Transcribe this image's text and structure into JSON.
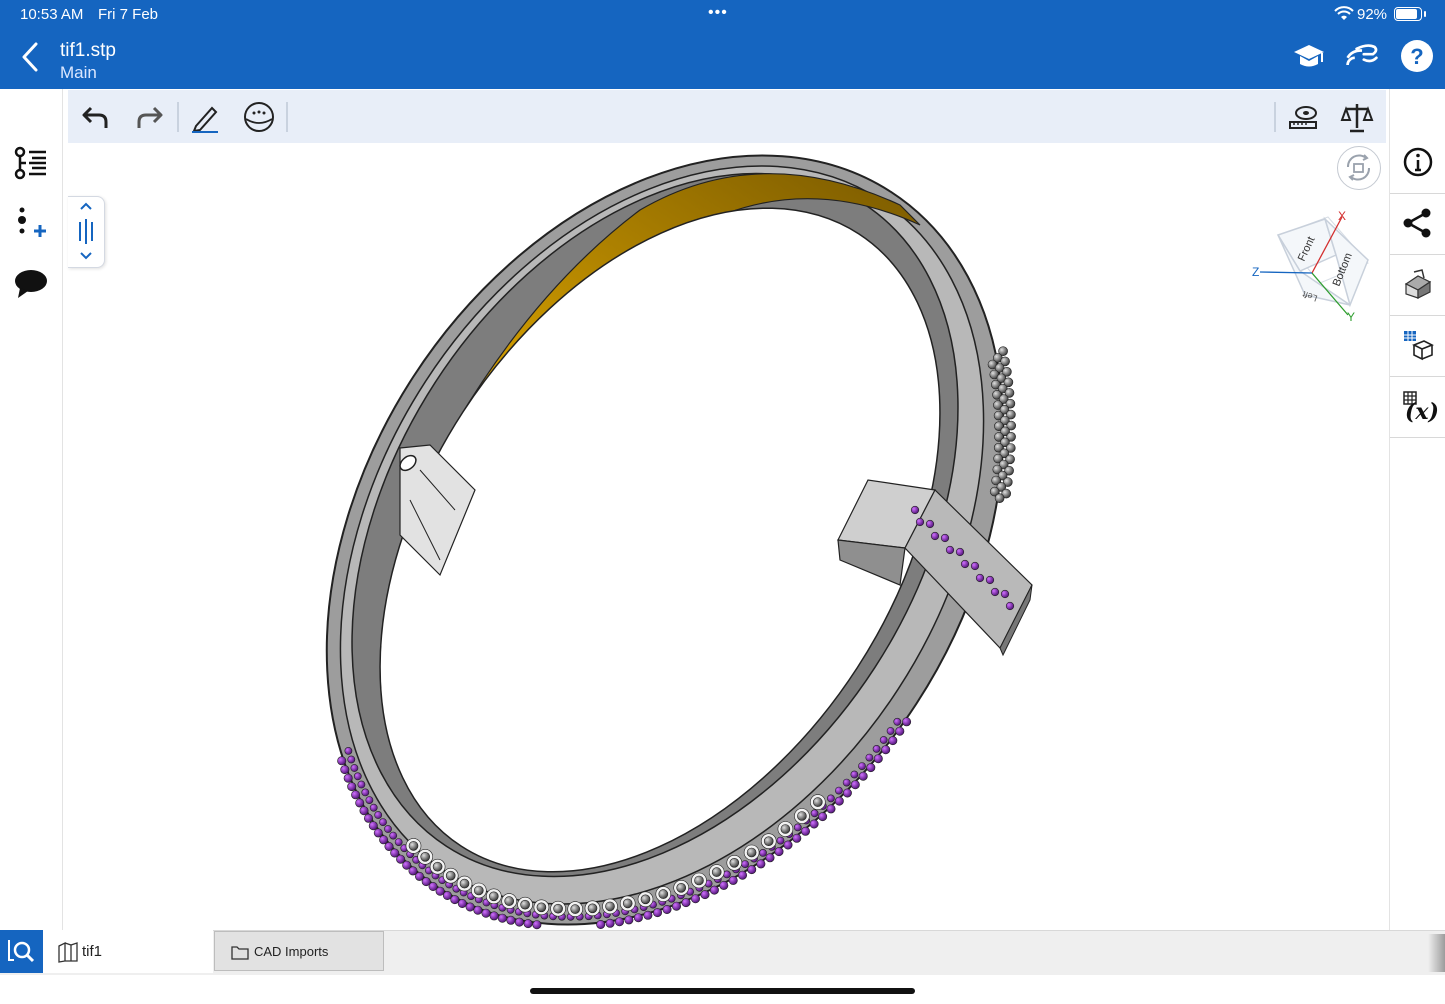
{
  "status_bar": {
    "time": "10:53 AM",
    "date": "Fri 7 Feb",
    "dots": "•••",
    "battery": "92%",
    "battery_level": 0.92
  },
  "header": {
    "title": "tif1.stp",
    "subtitle": "Main",
    "background": "#1565C0",
    "icons": [
      "back-chevron",
      "learning-center-icon",
      "follow-mode-icon",
      "help-icon"
    ]
  },
  "toolbar": {
    "icons": [
      "undo-icon",
      "redo-icon",
      "sketch-pencil-icon",
      "appearance-sphere-icon",
      "measure-tape-icon",
      "mass-properties-icon"
    ]
  },
  "left_rail": {
    "icons": [
      "feature-list-icon",
      "add-insert-icon",
      "comments-icon"
    ]
  },
  "right_rail": {
    "icons": [
      "info-icon",
      "share-icon",
      "render-style-icon",
      "configurations-icon",
      "variables-icon"
    ]
  },
  "viewcube": {
    "faces": [
      "Front",
      "Bottom",
      "Left"
    ],
    "axes": [
      "X",
      "Y",
      "Z"
    ],
    "axis_colors": {
      "X": "#d32f2f",
      "Y": "#2e9e2e",
      "Z": "#1565C0"
    }
  },
  "model": {
    "colors": {
      "body": "#a9a9a9",
      "inner_face": "#e0a000",
      "gems_purple": "#7b1fa2",
      "gems_gray": "#555555"
    }
  },
  "tabs": [
    {
      "label": "tif1",
      "active": true
    },
    {
      "label": "CAD Imports",
      "active": false
    }
  ]
}
